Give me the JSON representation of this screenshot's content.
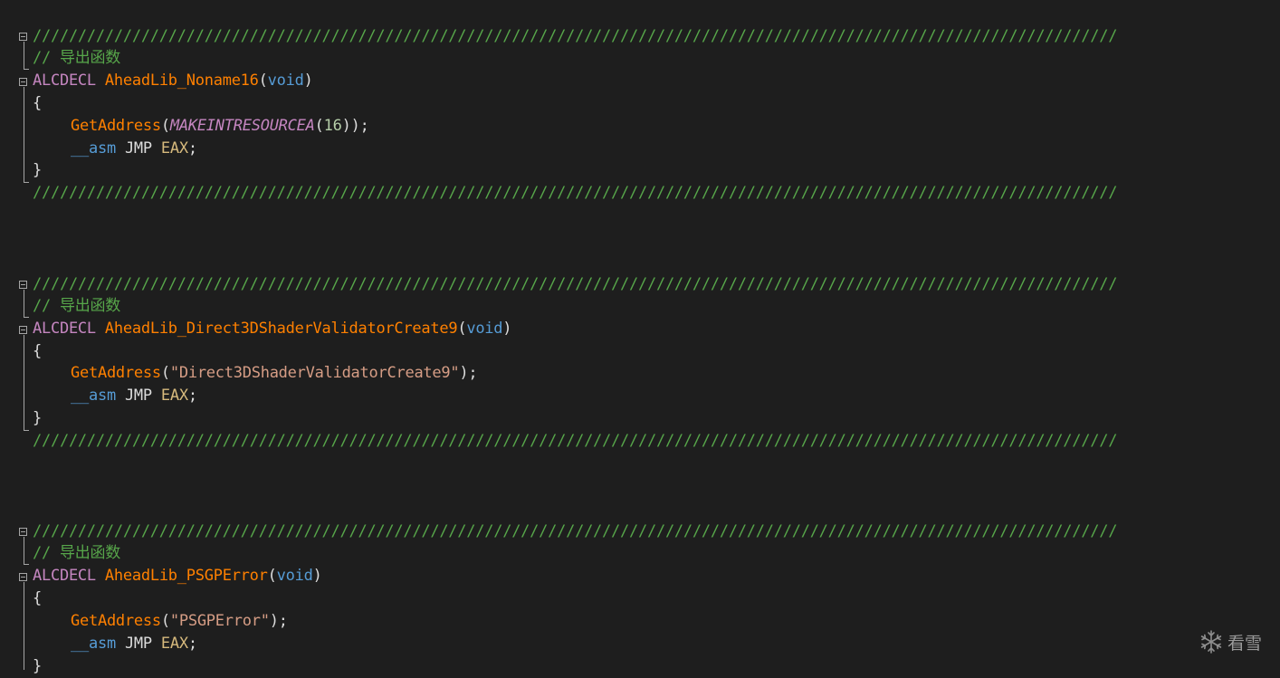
{
  "blocks": [
    {
      "separator": "////////////////////////////////////////////////////////////////////////////////////////////////////////////////////////",
      "comment": "// 导出函数",
      "macro": "ALCDECL",
      "func_name": "AheadLib_Noname16",
      "param_open": "(",
      "param": "void",
      "param_close": ")",
      "brace_open": "{",
      "call_name": "GetAddress",
      "call_arg_kind": "macro",
      "call_macro": "MAKEINTRESOURCEA",
      "call_number": "16",
      "asm_kw": "__asm",
      "asm_op": "JMP",
      "asm_reg": "EAX",
      "brace_close": "}",
      "separator_end": "////////////////////////////////////////////////////////////////////////////////////////////////////////////////////////"
    },
    {
      "separator": "////////////////////////////////////////////////////////////////////////////////////////////////////////////////////////",
      "comment": "// 导出函数",
      "macro": "ALCDECL",
      "func_name": "AheadLib_Direct3DShaderValidatorCreate9",
      "param_open": "(",
      "param": "void",
      "param_close": ")",
      "brace_open": "{",
      "call_name": "GetAddress",
      "call_arg_kind": "string",
      "call_string": "\"Direct3DShaderValidatorCreate9\"",
      "asm_kw": "__asm",
      "asm_op": "JMP",
      "asm_reg": "EAX",
      "brace_close": "}",
      "separator_end": "////////////////////////////////////////////////////////////////////////////////////////////////////////////////////////"
    },
    {
      "separator": "////////////////////////////////////////////////////////////////////////////////////////////////////////////////////////",
      "comment": "// 导出函数",
      "macro": "ALCDECL",
      "func_name": "AheadLib_PSGPError",
      "param_open": "(",
      "param": "void",
      "param_close": ")",
      "brace_open": "{",
      "call_name": "GetAddress",
      "call_arg_kind": "string",
      "call_string": "\"PSGPError\"",
      "asm_kw": "__asm",
      "asm_op": "JMP",
      "asm_reg": "EAX",
      "brace_close": "}"
    }
  ],
  "watermark": {
    "text": "看雪",
    "icon": "snowflake-icon"
  },
  "colors": {
    "background": "#1e1e1e",
    "comment": "#57a64a",
    "macro": "#c586c0",
    "function": "#ff8000",
    "keyword": "#569cd6",
    "string": "#d69d85",
    "number": "#b5cea8",
    "register": "#d7ba7d",
    "text": "#dcdcdc"
  }
}
